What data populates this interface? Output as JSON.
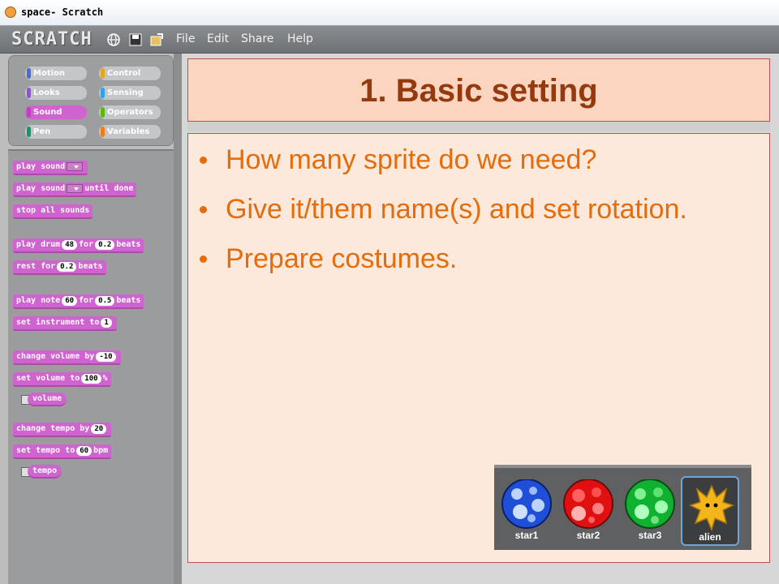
{
  "window": {
    "title": "space- Scratch"
  },
  "menubar": {
    "logo": "SCRATCH",
    "items": [
      "File",
      "Edit",
      "Share",
      "Help"
    ]
  },
  "categories": [
    {
      "label": "Motion",
      "color": "#4a6cd4"
    },
    {
      "label": "Control",
      "color": "#e1a91a"
    },
    {
      "label": "Looks",
      "color": "#8a55d7"
    },
    {
      "label": "Sensing",
      "color": "#2ca5e2"
    },
    {
      "label": "Sound",
      "color": "#bb42c3",
      "selected": true
    },
    {
      "label": "Operators",
      "color": "#5cb712"
    },
    {
      "label": "Pen",
      "color": "#0e9a6c"
    },
    {
      "label": "Variables",
      "color": "#ee7d16"
    }
  ],
  "blocks": {
    "play_sound": "play sound",
    "play_sound_until": {
      "a": "play sound",
      "b": "until done"
    },
    "stop_all": "stop all sounds",
    "play_drum": {
      "a": "play drum",
      "v1": "48",
      "b": "for",
      "v2": "0.2",
      "c": "beats"
    },
    "rest_for": {
      "a": "rest for",
      "v1": "0.2",
      "b": "beats"
    },
    "play_note": {
      "a": "play note",
      "v1": "60",
      "b": "for",
      "v2": "0.5",
      "c": "beats"
    },
    "set_instrument": {
      "a": "set instrument to",
      "v1": "1"
    },
    "change_volume": {
      "a": "change volume by",
      "v1": "-10"
    },
    "set_volume": {
      "a": "set volume to",
      "v1": "100",
      "b": "%"
    },
    "volume_reporter": "volume",
    "change_tempo": {
      "a": "change tempo by",
      "v1": "20"
    },
    "set_tempo": {
      "a": "set tempo to",
      "v1": "60",
      "b": "bpm"
    },
    "tempo_reporter": "tempo"
  },
  "slide": {
    "title": "1. Basic setting",
    "bullets": [
      "How many sprite do we need?",
      "Give it/them name(s) and set rotation.",
      "Prepare costumes."
    ]
  },
  "sprites": [
    {
      "name": "star1",
      "color": "#1f4fd6"
    },
    {
      "name": "star2",
      "color": "#e01010"
    },
    {
      "name": "star3",
      "color": "#10b030"
    },
    {
      "name": "alien",
      "color": "#f2b51c",
      "selected": true
    }
  ]
}
